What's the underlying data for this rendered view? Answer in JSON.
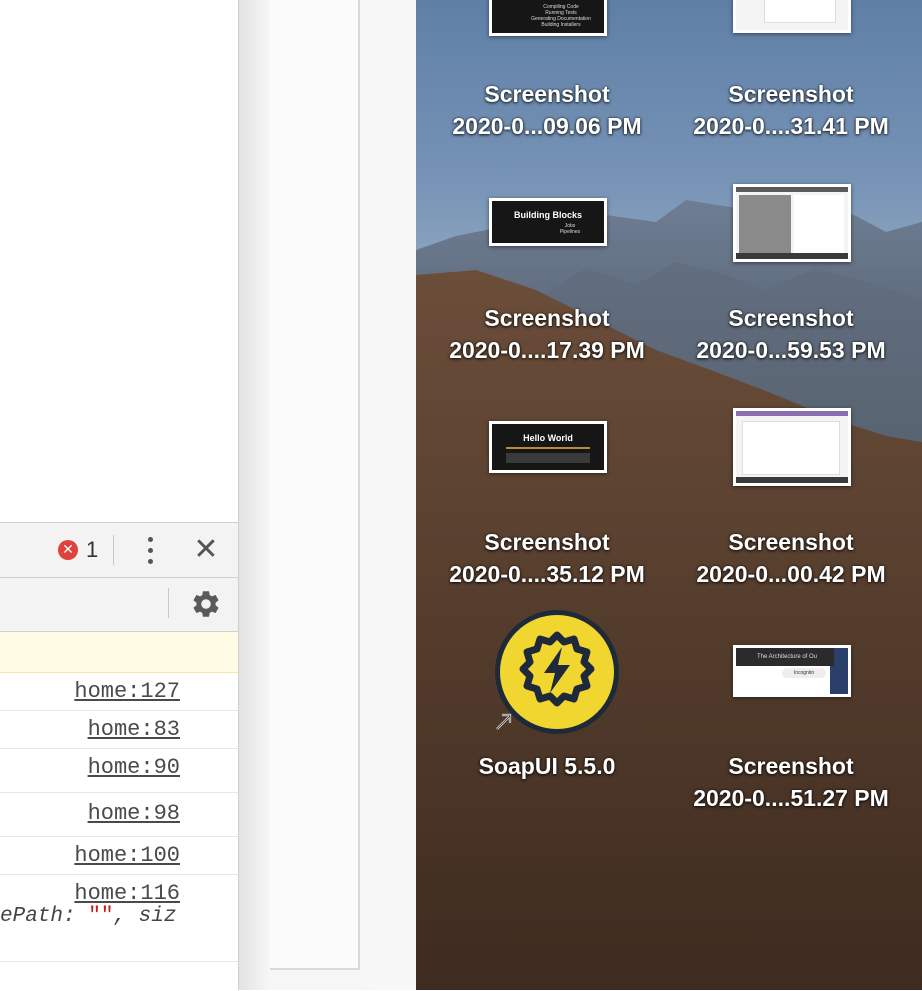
{
  "devtools": {
    "error_count": "1",
    "log_links": [
      "home:127",
      "home:83",
      "home:90",
      "home:98",
      "home:100",
      "home:116"
    ],
    "code_prefix": "ePath",
    "code_colon": ": ",
    "code_string": "\"\"",
    "code_suffix": ", siz"
  },
  "desktop": {
    "icons": [
      {
        "line1": "Screenshot",
        "line2": "2020-0...09.06 PM",
        "thumb": "slide-build-list"
      },
      {
        "line1": "Screenshot",
        "line2": "2020-0....31.41 PM",
        "thumb": "white-page"
      },
      {
        "line1": "Screenshot",
        "line2": "2020-0....17.39 PM",
        "thumb": "slide-building-blocks"
      },
      {
        "line1": "Screenshot",
        "line2": "2020-0...59.53 PM",
        "thumb": "browser-window"
      },
      {
        "line1": "Screenshot",
        "line2": "2020-0....35.12 PM",
        "thumb": "slide-hello-world"
      },
      {
        "line1": "Screenshot",
        "line2": "2020-0...00.42 PM",
        "thumb": "browser-window"
      },
      {
        "line1": "SoapUI 5.5.0",
        "line2": "",
        "thumb": "soapui-app-icon"
      },
      {
        "line1": "Screenshot",
        "line2": "2020-0....51.27 PM",
        "thumb": "browser-tab"
      }
    ],
    "slide1_bullets": [
      "Compiling Code",
      "Running Tests",
      "Generating Documentation",
      "Building Installers"
    ],
    "slide2_title": "Building Blocks",
    "slide2_bullets": [
      "Jobs",
      "Pipelines"
    ],
    "slide3_title": "Hello World",
    "tab_title": "The Architecture of Ou",
    "incognito_label": "Incognito"
  },
  "colors": {
    "error_red": "#e0413a",
    "soapui_yellow": "#f2d630",
    "soapui_navy": "#1e2a3a",
    "warning_bg": "#fffbe5"
  }
}
